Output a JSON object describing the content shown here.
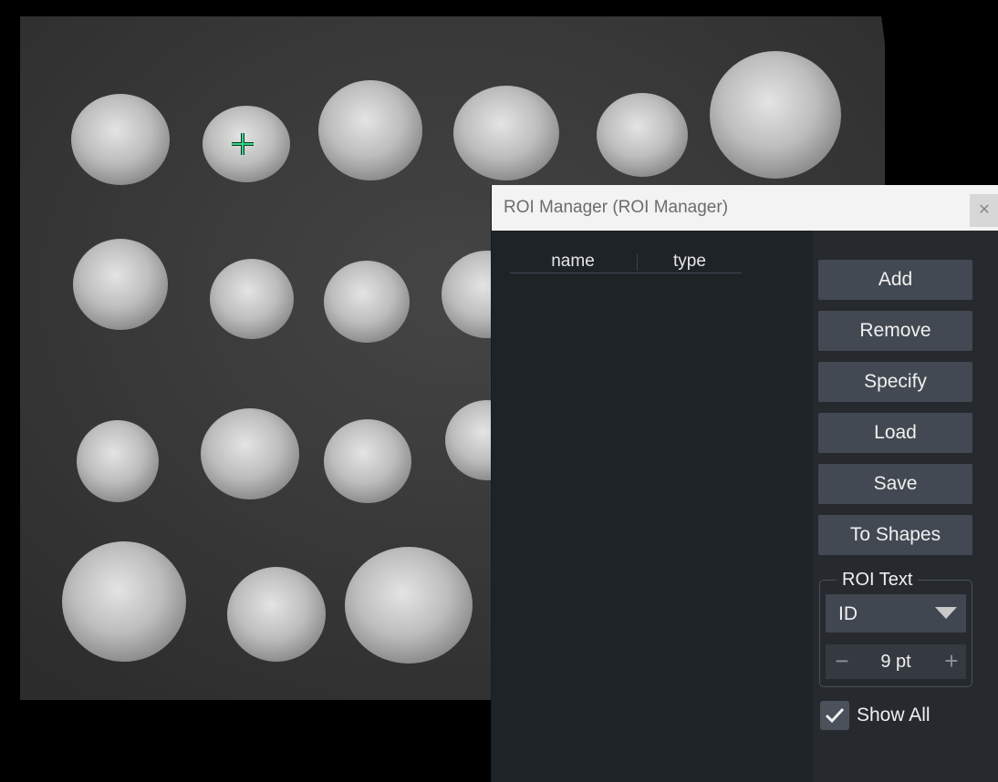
{
  "image": {
    "alt_icon": "coins-image",
    "coin_rows": 4,
    "marker": "crosshair-icon",
    "marker_color": "#36d18a"
  },
  "roi_manager": {
    "title": "ROI Manager (ROI Manager)",
    "close_icon": "close-icon",
    "columns": [
      "name",
      "type"
    ],
    "buttons": {
      "add": "Add",
      "remove": "Remove",
      "specify": "Specify",
      "load": "Load",
      "save": "Save",
      "to_shapes": "To Shapes"
    },
    "roi_text": {
      "label": "ROI Text",
      "selected": "ID",
      "font_size": "9 pt",
      "minus": "−",
      "plus": "+"
    },
    "show_all": {
      "label": "Show All",
      "checked": true
    }
  }
}
